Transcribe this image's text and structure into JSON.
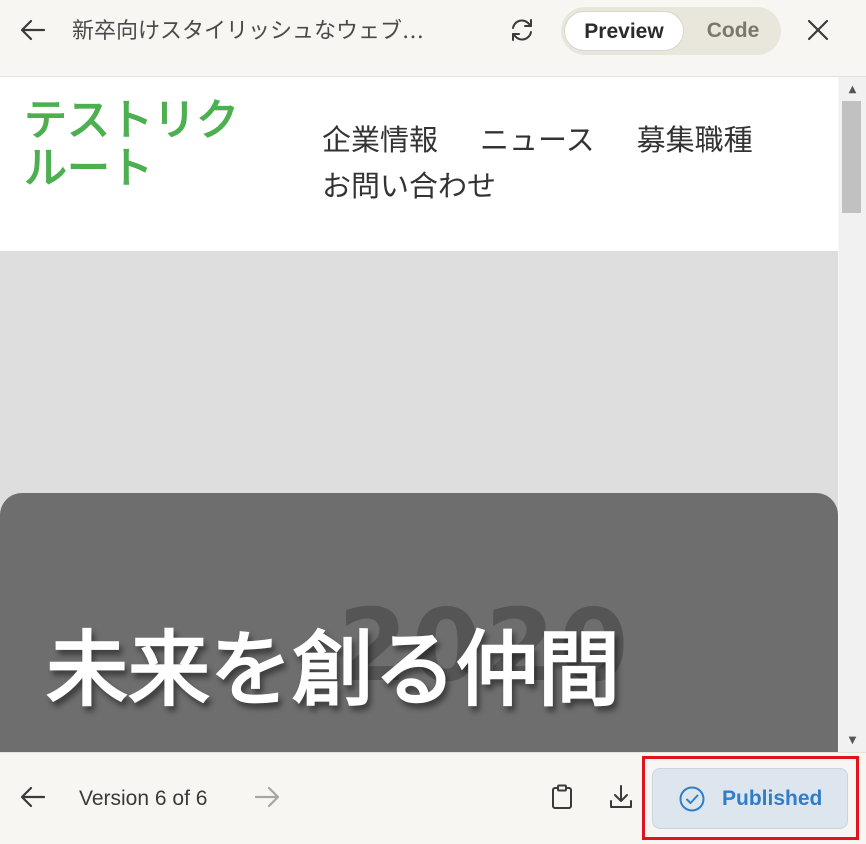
{
  "topbar": {
    "back_icon": "arrow-left-icon",
    "title": "新卒向けスタイリッシュなウェブ…",
    "refresh_icon": "refresh-icon",
    "toggle": {
      "preview_label": "Preview",
      "code_label": "Code",
      "selected": "Preview"
    },
    "close_icon": "close-icon"
  },
  "preview": {
    "logo": "テストリクルート",
    "nav": [
      "企業情報",
      "ニュース",
      "募集職種",
      "お問い合わせ"
    ],
    "hero": {
      "ghost_text": "2020",
      "title": "未来を創る仲間"
    },
    "colors": {
      "logo": "#4caf50",
      "hero_bg": "#dedede",
      "hero_card": "#6e6e6e"
    }
  },
  "bottombar": {
    "prev_icon": "arrow-left-icon",
    "version_label": "Version 6 of 6",
    "next_icon": "arrow-right-icon",
    "copy_icon": "clipboard-icon",
    "download_icon": "download-icon",
    "published_label": "Published",
    "published_icon": "check-circle-icon",
    "colors": {
      "published_text": "#2f7ec7",
      "highlight": "#e0141e"
    }
  }
}
